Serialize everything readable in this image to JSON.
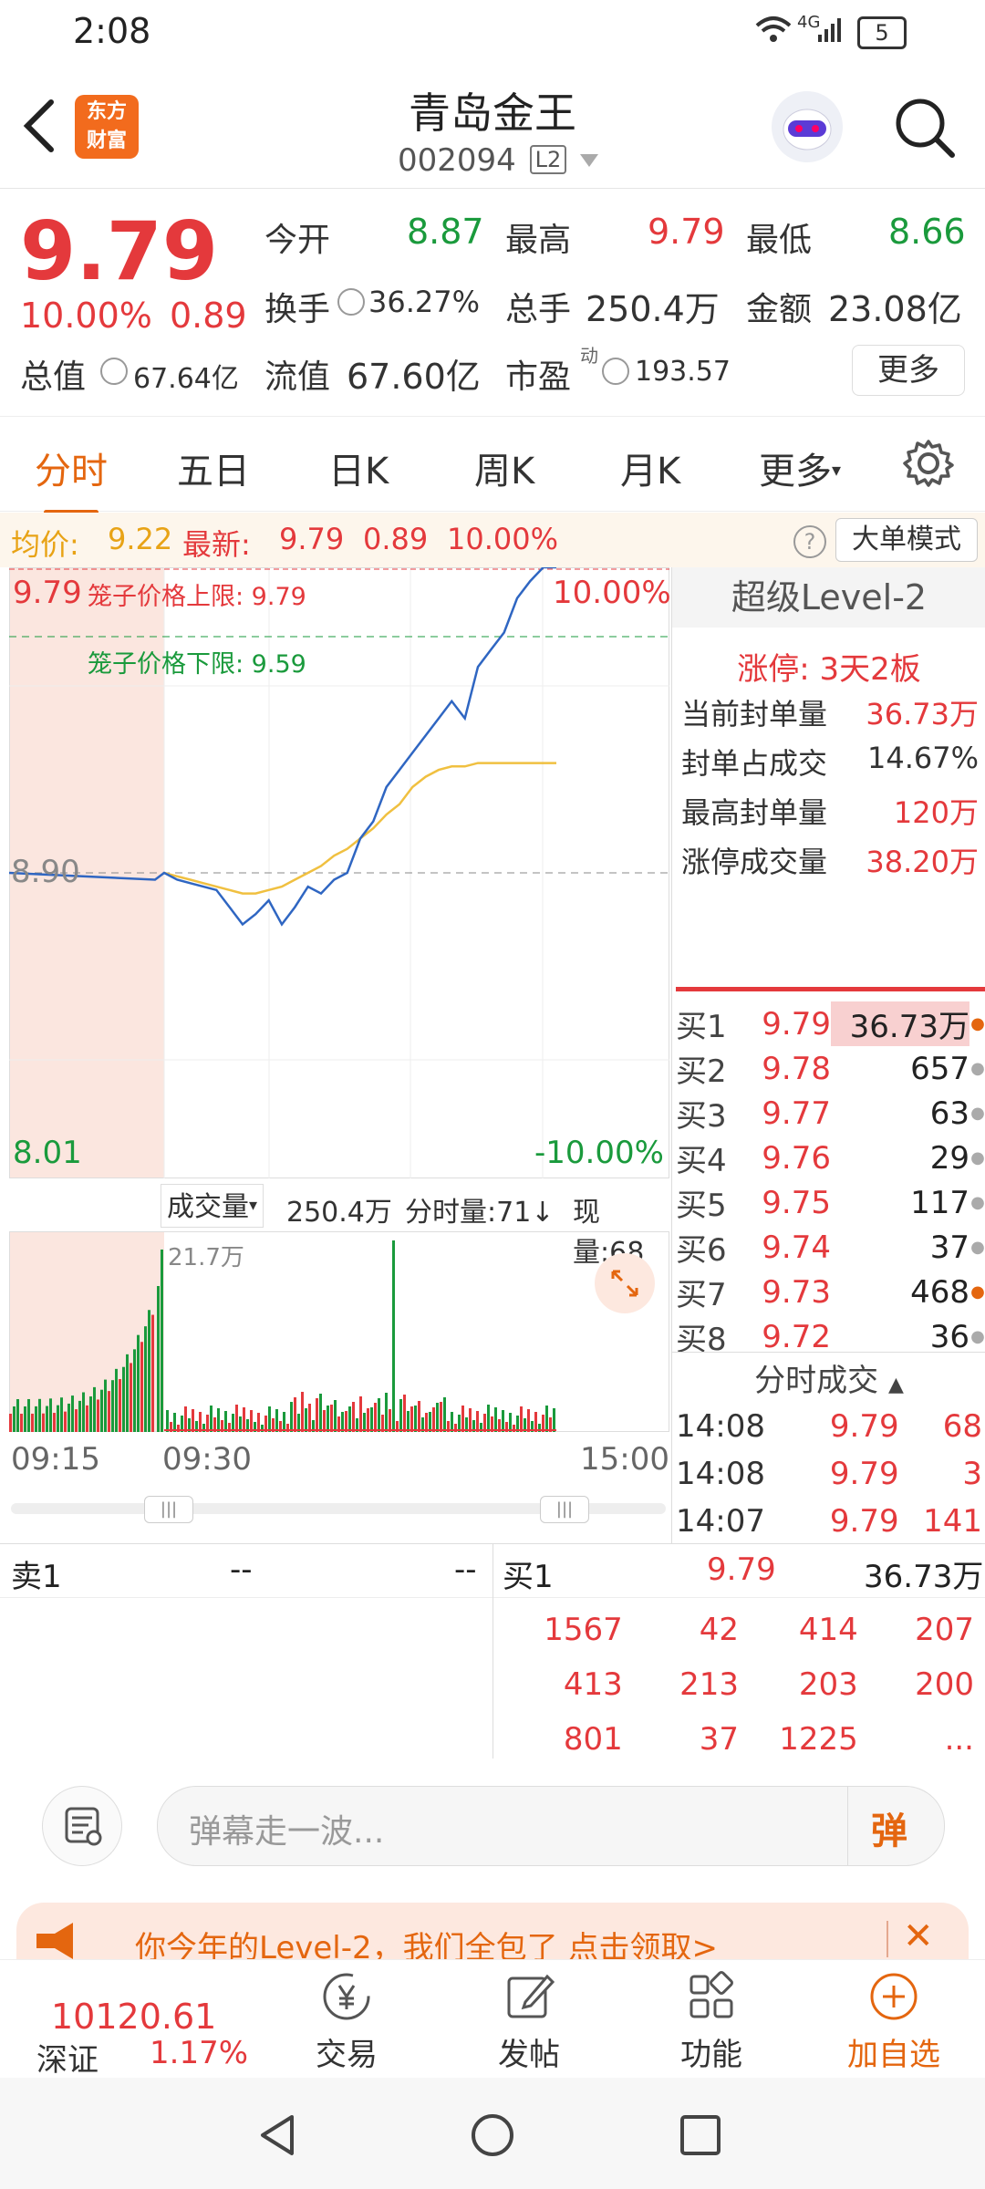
{
  "status": {
    "time": "2:08",
    "network": "4G",
    "battery": "5"
  },
  "header": {
    "title": "青岛金王",
    "code": "002094",
    "l2_badge": "L2",
    "brand_line1": "东方",
    "brand_line2": "财富"
  },
  "quote": {
    "price": "9.79",
    "pct": "10.00%",
    "chg": "0.89",
    "open_label": "今开",
    "open": "8.87",
    "high_label": "最高",
    "high": "9.79",
    "low_label": "最低",
    "low": "8.66",
    "turnover_label": "换手",
    "turnover": "36.27%",
    "volume_label": "总手",
    "volume": "250.4万",
    "amount_label": "金额",
    "amount": "23.08亿",
    "mktcap_label": "总值",
    "mktcap": "67.64亿",
    "float_label": "流值",
    "float": "67.60亿",
    "pe_label": "市盈",
    "pe_sup": "动",
    "pe": "193.57",
    "more": "更多"
  },
  "tabs": [
    "分时",
    "五日",
    "日K",
    "周K",
    "月K",
    "更多"
  ],
  "infobar": {
    "avg_label": "均价:",
    "avg": "9.22",
    "latest_label": "最新:",
    "latest": "9.79",
    "chg": "0.89",
    "pct": "10.00%",
    "mode": "大单模式"
  },
  "chart": {
    "top_price": "9.79",
    "upper_limit_text": "笼子价格上限: 9.79",
    "lower_limit_text": "笼子价格下限: 9.59",
    "top_pct": "10.00%",
    "mid_price": "8.90",
    "bottom_price": "8.01",
    "bottom_pct": "-10.00%",
    "colors": {
      "price": "#2f66c2",
      "avg": "#f0c040",
      "up": "#e4393c",
      "down": "#1a9a3c",
      "premarket": "#fbe6df"
    }
  },
  "chart_data": {
    "type": "line",
    "series": [
      {
        "name": "price",
        "values": [
          8.9,
          8.88,
          8.87,
          8.86,
          8.85,
          8.8,
          8.75,
          8.78,
          8.82,
          8.75,
          8.8,
          8.86,
          8.84,
          8.88,
          8.9,
          9.0,
          9.05,
          9.15,
          9.2,
          9.25,
          9.3,
          9.35,
          9.4,
          9.35,
          9.5,
          9.55,
          9.6,
          9.7,
          9.75,
          9.79,
          9.79
        ]
      },
      {
        "name": "avg",
        "values": [
          8.9,
          8.89,
          8.88,
          8.87,
          8.86,
          8.85,
          8.84,
          8.84,
          8.85,
          8.86,
          8.88,
          8.9,
          8.92,
          8.95,
          8.97,
          9.0,
          9.03,
          9.07,
          9.1,
          9.15,
          9.18,
          9.2,
          9.21,
          9.21,
          9.22,
          9.22,
          9.22,
          9.22,
          9.22,
          9.22,
          9.22
        ]
      }
    ],
    "ylim": [
      8.01,
      9.79
    ]
  },
  "volume": {
    "label": "成交量",
    "total": "250.4万",
    "fenshi": "分时量:71↓",
    "now": "现量:68",
    "peak": "21.7万",
    "t_start": "09:15",
    "t_open": "09:30",
    "t_end": "15:00"
  },
  "level2": {
    "title": "超级Level-2",
    "limit": "涨停: 3天2板",
    "rows": [
      {
        "label": "当前封单量",
        "value": "36.73万"
      },
      {
        "label": "封单占成交",
        "value": "14.67%"
      },
      {
        "label": "最高封单量",
        "value": "120万"
      },
      {
        "label": "涨停成交量",
        "value": "38.20万"
      }
    ],
    "bids": [
      {
        "label": "买1",
        "price": "9.79",
        "vol": "36.73万"
      },
      {
        "label": "买2",
        "price": "9.78",
        "vol": "657"
      },
      {
        "label": "买3",
        "price": "9.77",
        "vol": "63"
      },
      {
        "label": "买4",
        "price": "9.76",
        "vol": "29"
      },
      {
        "label": "买5",
        "price": "9.75",
        "vol": "117"
      },
      {
        "label": "买6",
        "price": "9.74",
        "vol": "37"
      },
      {
        "label": "买7",
        "price": "9.73",
        "vol": "468"
      },
      {
        "label": "买8",
        "price": "9.72",
        "vol": "36"
      }
    ],
    "ticks_title": "分时成交",
    "ticks": [
      {
        "time": "14:08",
        "price": "9.79",
        "vol": "68"
      },
      {
        "time": "14:08",
        "price": "9.79",
        "vol": "3"
      },
      {
        "time": "14:07",
        "price": "9.79",
        "vol": "141"
      }
    ]
  },
  "queue": {
    "sell_label": "卖1",
    "sell_price": "--",
    "sell_vol": "--",
    "buy_label": "买1",
    "buy_price": "9.79",
    "buy_vol": "36.73万",
    "grid": [
      [
        "1567",
        "42",
        "414",
        "207"
      ],
      [
        "413",
        "213",
        "203",
        "200"
      ],
      [
        "801",
        "37",
        "1225",
        "..."
      ]
    ]
  },
  "danmu": {
    "placeholder": "弹幕走一波...",
    "send": "弹"
  },
  "banner": {
    "text": "你今年的Level-2，我们全包了 点击领取>"
  },
  "bottom": {
    "index_value": "10120.61",
    "index_name": "深证",
    "index_pct": "1.17%",
    "items": [
      "交易",
      "发帖",
      "功能",
      "加自选"
    ]
  }
}
